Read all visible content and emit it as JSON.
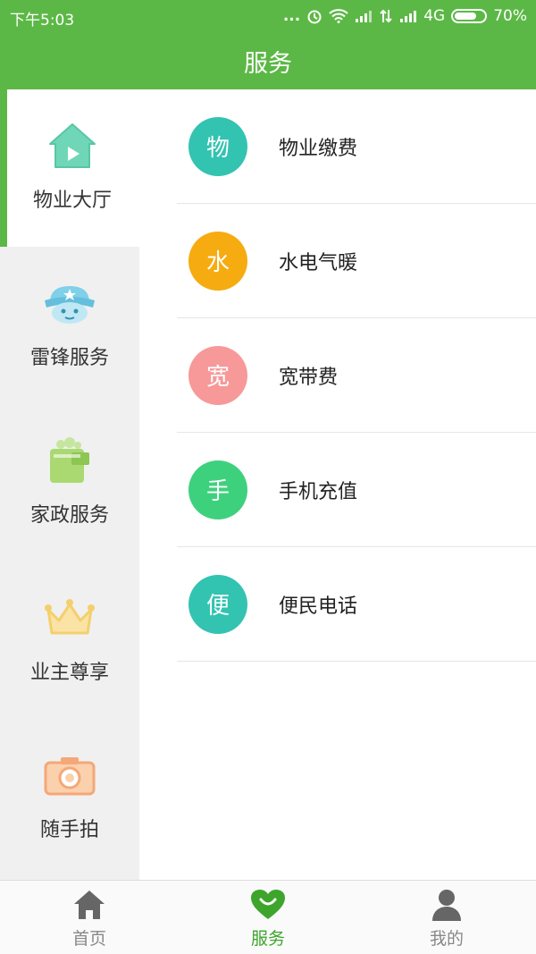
{
  "status_bar": {
    "time": "下午5:03",
    "dots": "...",
    "network": "4G",
    "battery": "70%"
  },
  "header": {
    "title": "服务"
  },
  "sidebar": {
    "items": [
      {
        "label": "物业大厅",
        "icon": "house-play-icon",
        "color": "#6fd6b8",
        "active": true
      },
      {
        "label": "雷锋服务",
        "icon": "soldier-cap-icon",
        "color": "#7fd0e8",
        "active": false
      },
      {
        "label": "家政服务",
        "icon": "cleaning-bucket-icon",
        "color": "#a9d970",
        "active": false
      },
      {
        "label": "业主尊享",
        "icon": "crown-icon",
        "color": "#f7d57a",
        "active": false
      },
      {
        "label": "随手拍",
        "icon": "camera-icon",
        "color": "#f7b98a",
        "active": false
      }
    ]
  },
  "services": [
    {
      "badge": "物",
      "label": "物业缴费",
      "color": "#33c3b1"
    },
    {
      "badge": "水",
      "label": "水电气暖",
      "color": "#f6ab10"
    },
    {
      "badge": "宽",
      "label": "宽带费",
      "color": "#f79999"
    },
    {
      "badge": "手",
      "label": "手机充值",
      "color": "#3ed17d"
    },
    {
      "badge": "便",
      "label": "便民电话",
      "color": "#33c3b1"
    }
  ],
  "bottom_nav": {
    "items": [
      {
        "label": "首页",
        "icon": "home-icon",
        "active": false
      },
      {
        "label": "服务",
        "icon": "heart-icon",
        "active": true
      },
      {
        "label": "我的",
        "icon": "person-icon",
        "active": false
      }
    ]
  },
  "colors": {
    "brand": "#5cb846",
    "active_text": "#3ea52c"
  }
}
